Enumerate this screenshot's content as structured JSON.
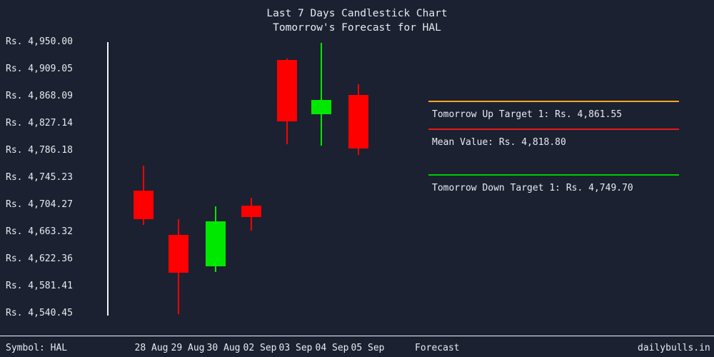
{
  "brand": "dailybulls.in",
  "title": {
    "line1": "Last 7 Days Candlestick Chart",
    "line2": "Tomorrow's Forecast for HAL"
  },
  "symbol_label": "Symbol: HAL",
  "forecast_axis_label": "Forecast",
  "colors": {
    "background": "#1b2130",
    "text": "#e8eaf0",
    "axis": "#f2f4f8",
    "up": "#00e800",
    "down": "#fe0000",
    "up_target_rule": "#f5a623",
    "mean_rule": "#e81b1b",
    "down_target_rule": "#00cc00"
  },
  "forecast_panel": {
    "up_target": {
      "rule_color": "#f5a623",
      "label": "Tomorrow Up Target 1: Rs. 4,861.55",
      "value": 4861.55
    },
    "mean": {
      "rule_color": "#e81b1b",
      "label": "Mean Value: Rs. 4,818.80",
      "value": 4818.8
    },
    "down_target": {
      "rule_color": "#00cc00",
      "label": "Tomorrow Down Target 1: Rs. 4,749.70",
      "value": 4749.7
    }
  },
  "y_axis": {
    "labels": [
      "Rs. 4,950.00",
      "Rs. 4,909.05",
      "Rs. 4,868.09",
      "Rs. 4,827.14",
      "Rs. 4,786.18",
      "Rs. 4,745.23",
      "Rs. 4,704.27",
      "Rs. 4,663.32",
      "Rs. 4,622.36",
      "Rs. 4,581.41",
      "Rs. 4,540.45"
    ],
    "values": [
      4950.0,
      4909.05,
      4868.09,
      4827.14,
      4786.18,
      4745.23,
      4704.27,
      4663.32,
      4622.36,
      4581.41,
      4540.45
    ],
    "min": 4540.45,
    "max": 4950.0
  },
  "chart_data": {
    "type": "candlestick",
    "title": "Last 7 Days Candlestick Chart / Tomorrow's Forecast for HAL",
    "symbol": "HAL",
    "currency": "Rs.",
    "xlabel": "",
    "ylabel": "",
    "ylim": [
      4540.45,
      4950.0
    ],
    "grid": false,
    "legend": null,
    "categories": [
      "28 Aug",
      "29 Aug",
      "30 Aug",
      "02 Sep",
      "03 Sep",
      "04 Sep",
      "05 Sep"
    ],
    "candles": [
      {
        "date": "28 Aug",
        "open": 4755.0,
        "high": 4792.5,
        "close": 4712.0,
        "low": 4703.5,
        "direction": "down"
      },
      {
        "date": "29 Aug",
        "open": 4688.0,
        "high": 4711.5,
        "close": 4631.0,
        "low": 4568.5,
        "direction": "down"
      },
      {
        "date": "30 Aug",
        "open": 4636.0,
        "high": 4711.5,
        "close": 4703.5,
        "low": 4627.0,
        "direction": "up"
      },
      {
        "date": "02 Sep",
        "open": 4719.0,
        "high": 4730.0,
        "close": 4701.5,
        "low": 4681.0,
        "direction": "down"
      },
      {
        "date": "03 Sep",
        "open": 4923.0,
        "high": 4925.0,
        "close": 4830.0,
        "low": 4795.5,
        "direction": "down"
      },
      {
        "date": "04 Sep",
        "open": 4846.0,
        "high": 4948.0,
        "close": 4867.5,
        "low": 4793.5,
        "direction": "up"
      },
      {
        "date": "05 Sep",
        "open": 4877.5,
        "high": 4894.0,
        "close": 4796.5,
        "low": 4787.0,
        "direction": "down"
      }
    ],
    "forecast": {
      "up_target_1": 4861.55,
      "mean_value": 4818.8,
      "down_target_1": 4749.7
    }
  },
  "geometry": {
    "y_tick_tops": [
      52,
      90,
      128,
      166,
      204,
      242,
      280,
      318,
      356,
      394,
      432
    ],
    "candles": [
      {
        "cx": 201,
        "wick_top": 232,
        "wick_bottom": 315,
        "body_top": 267,
        "body_bottom": 307
      },
      {
        "cx": 250,
        "wick_top": 307,
        "wick_bottom": 440,
        "body_top": 329,
        "body_bottom": 382
      },
      {
        "cx": 302,
        "wick_top": 289,
        "wick_bottom": 381,
        "body_top": 310,
        "body_bottom": 373
      },
      {
        "cx": 352,
        "wick_top": 277,
        "wick_bottom": 323,
        "body_top": 288,
        "body_bottom": 304
      },
      {
        "cx": 402,
        "wick_top": 82,
        "wick_bottom": 202,
        "body_top": 84,
        "body_bottom": 170
      },
      {
        "cx": 450,
        "wick_top": 60,
        "wick_bottom": 204,
        "body_top": 140,
        "body_bottom": 160
      },
      {
        "cx": 502,
        "wick_top": 118,
        "wick_bottom": 217,
        "body_top": 133,
        "body_bottom": 208
      }
    ],
    "date_label_x": [
      212,
      263,
      313,
      364,
      414,
      465,
      515
    ],
    "rule_tops": [
      141,
      180,
      244
    ],
    "text_tops": [
      154,
      193,
      257
    ]
  }
}
